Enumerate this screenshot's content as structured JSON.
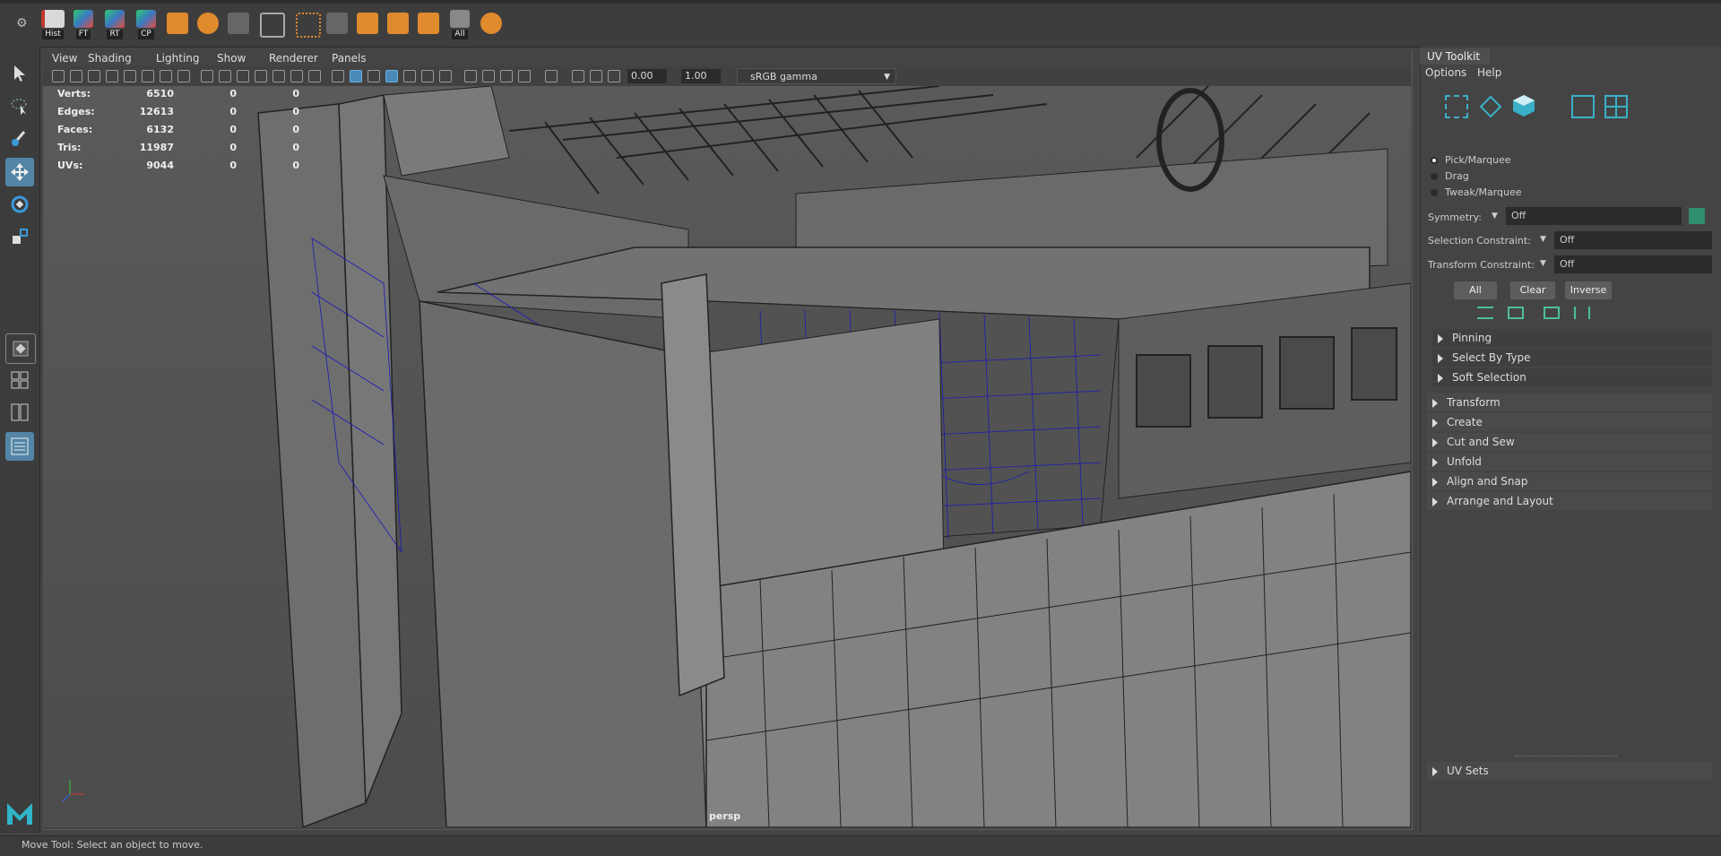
{
  "shelf": {
    "buttons": [
      {
        "label": "Hist",
        "color": "#c0392b"
      },
      {
        "label": "FT",
        "color": "#3a78c2"
      },
      {
        "label": "RT",
        "color": "#3a78c2"
      },
      {
        "label": "CP",
        "color": "#3a78c2"
      },
      {
        "label": "All",
        "color": "#555555"
      }
    ]
  },
  "viewport": {
    "menu": [
      "View",
      "Shading",
      "Lighting",
      "Show",
      "Renderer",
      "Panels"
    ],
    "field1": "0.00",
    "field2": "1.00",
    "colorspace": "sRGB gamma",
    "hud": [
      {
        "label": "Verts:",
        "value": "6510",
        "a": "0",
        "b": "0"
      },
      {
        "label": "Edges:",
        "value": "12613",
        "a": "0",
        "b": "0"
      },
      {
        "label": "Faces:",
        "value": "6132",
        "a": "0",
        "b": "0"
      },
      {
        "label": "Tris:",
        "value": "11987",
        "a": "0",
        "b": "0"
      },
      {
        "label": "UVs:",
        "value": "9044",
        "a": "0",
        "b": "0"
      }
    ],
    "camera": "persp"
  },
  "uv_toolkit": {
    "tab": "UV Toolkit",
    "menu": [
      "Options",
      "Help"
    ],
    "modes": [
      "Pick/Marquee",
      "Drag",
      "Tweak/Marquee"
    ],
    "symmetry": {
      "label": "Symmetry:",
      "value": "Off"
    },
    "selection_constraint": {
      "label": "Selection Constraint:",
      "value": "Off"
    },
    "transform_constraint": {
      "label": "Transform Constraint:",
      "value": "Off"
    },
    "buttons": [
      "All",
      "Clear",
      "Inverse"
    ],
    "subsections": [
      "Pinning",
      "Select By Type",
      "Soft Selection"
    ],
    "sections": [
      "Transform",
      "Create",
      "Cut and Sew",
      "Unfold",
      "Align and Snap",
      "Arrange and Layout"
    ],
    "uv_sets": "UV Sets"
  },
  "status": "Move Tool: Select an object to move.",
  "colors": {
    "accent": "#5285a6",
    "wire": "#1a1ab4",
    "mesh": "#6e6e6e"
  }
}
